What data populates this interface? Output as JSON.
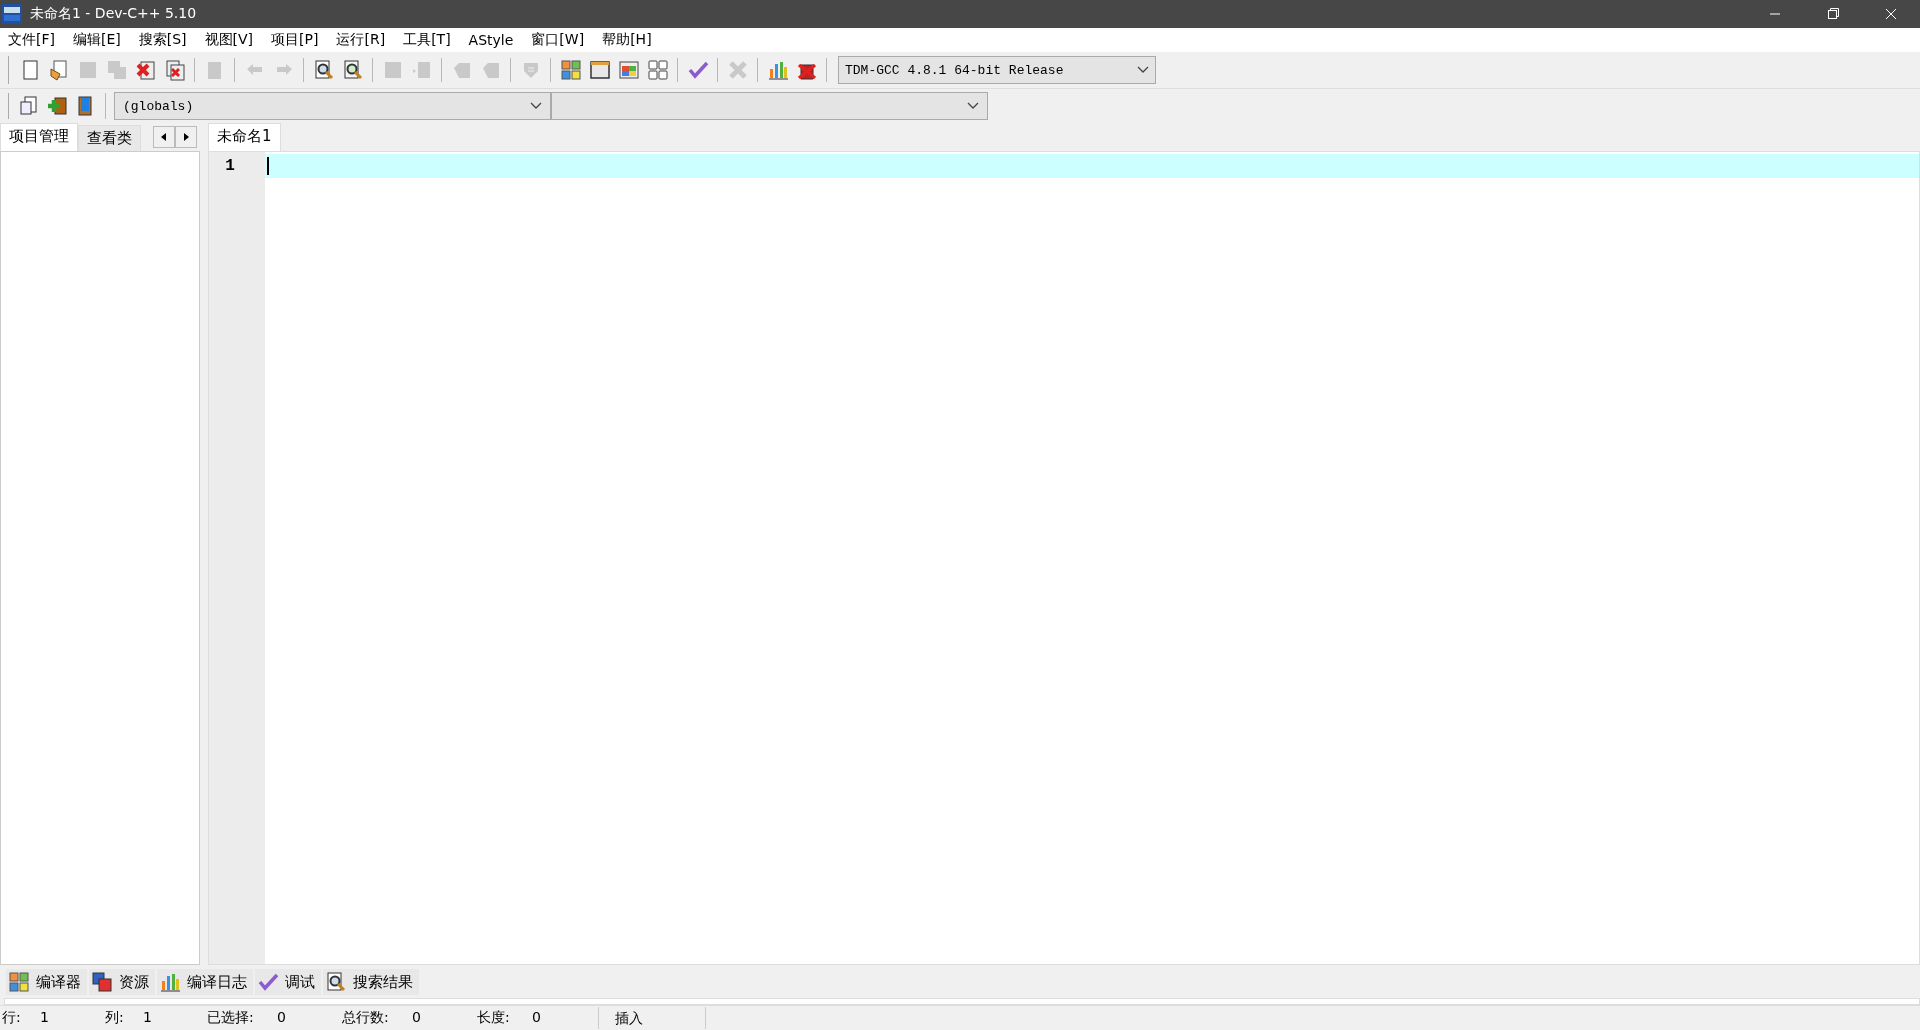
{
  "window": {
    "title": "未命名1 - Dev-C++ 5.10"
  },
  "menu": [
    "文件[F]",
    "编辑[E]",
    "搜索[S]",
    "视图[V]",
    "项目[P]",
    "运行[R]",
    "工具[T]",
    "AStyle",
    "窗口[W]",
    "帮助[H]"
  ],
  "toolbar": [
    {
      "kind": "new",
      "disabled": false
    },
    {
      "kind": "open",
      "disabled": false
    },
    {
      "kind": "save",
      "disabled": true
    },
    {
      "kind": "saveall",
      "disabled": true
    },
    {
      "kind": "close",
      "disabled": false
    },
    {
      "kind": "closeall",
      "disabled": false
    },
    {
      "kind": "sep"
    },
    {
      "kind": "print",
      "disabled": true
    },
    {
      "kind": "sep"
    },
    {
      "kind": "undo",
      "disabled": true
    },
    {
      "kind": "redo",
      "disabled": true
    },
    {
      "kind": "sep"
    },
    {
      "kind": "find",
      "disabled": false
    },
    {
      "kind": "replace",
      "disabled": false
    },
    {
      "kind": "sep"
    },
    {
      "kind": "block",
      "disabled": true
    },
    {
      "kind": "blocknext",
      "disabled": true
    },
    {
      "kind": "sep"
    },
    {
      "kind": "bookprev",
      "disabled": true
    },
    {
      "kind": "booknext",
      "disabled": true
    },
    {
      "kind": "sep"
    },
    {
      "kind": "shield",
      "disabled": true
    },
    {
      "kind": "sep"
    },
    {
      "kind": "compile",
      "disabled": false
    },
    {
      "kind": "run",
      "disabled": false
    },
    {
      "kind": "compilerun",
      "disabled": false
    },
    {
      "kind": "rebuild",
      "disabled": false
    },
    {
      "kind": "sep"
    },
    {
      "kind": "check",
      "disabled": false
    },
    {
      "kind": "sep"
    },
    {
      "kind": "stop",
      "disabled": true
    },
    {
      "kind": "sep"
    },
    {
      "kind": "chart",
      "disabled": false
    },
    {
      "kind": "debug",
      "disabled": false
    }
  ],
  "compiler_select": {
    "value": "TDM-GCC 4.8.1 64-bit Release"
  },
  "toolbar2": [
    {
      "kind": "newclass"
    },
    {
      "kind": "add"
    },
    {
      "kind": "book"
    }
  ],
  "scope_select": {
    "value": "(globals)"
  },
  "left_tabs": [
    {
      "label": "项目管理",
      "selected": true
    },
    {
      "label": "查看类",
      "selected": false
    }
  ],
  "editor_tabs": [
    {
      "label": "未命名1",
      "selected": true
    }
  ],
  "editor": {
    "lines": [
      {
        "number": "1",
        "current": true
      }
    ]
  },
  "bottom_tabs": [
    {
      "label": "编译器",
      "kind": "compile"
    },
    {
      "label": "资源",
      "kind": "resources"
    },
    {
      "label": "编译日志",
      "kind": "chart"
    },
    {
      "label": "调试",
      "kind": "check"
    },
    {
      "label": "搜索结果",
      "kind": "find"
    }
  ],
  "status_bar": {
    "fields": [
      {
        "label": "行:",
        "value": "1"
      },
      {
        "label": "列:",
        "value": "1"
      },
      {
        "label": "已选择:",
        "value": "0"
      },
      {
        "label": "总行数:",
        "value": "0"
      },
      {
        "label": "长度:",
        "value": "0"
      }
    ],
    "mode": "插入"
  }
}
